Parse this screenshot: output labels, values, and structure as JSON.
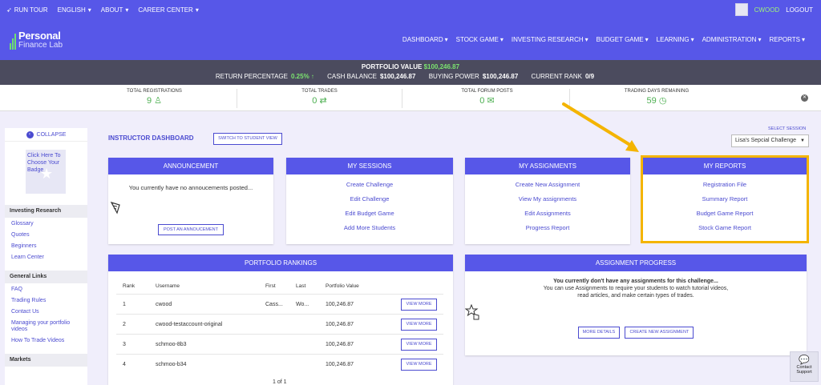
{
  "topbar": {
    "run_tour": "RUN TOUR",
    "english": "ENGLISH",
    "about": "ABOUT",
    "career_center": "CAREER CENTER",
    "username": "CWOOD",
    "logout": "LOGOUT"
  },
  "logo": {
    "line1": "Personal",
    "line2": "Finance Lab"
  },
  "nav": [
    "DASHBOARD",
    "STOCK GAME",
    "INVESTING RESEARCH",
    "BUDGET GAME",
    "LEARNING",
    "ADMINISTRATION",
    "REPORTS"
  ],
  "portfolio": {
    "value_label": "PORTFOLIO VALUE",
    "value": "$100,246.87",
    "return_label": "RETURN PERCENTAGE",
    "return_value": "0.25%",
    "cash_label": "CASH BALANCE",
    "cash_value": "$100,246.87",
    "bp_label": "BUYING POWER",
    "bp_value": "$100,246.87",
    "rank_label": "CURRENT RANK",
    "rank_value": "0/9"
  },
  "stats": [
    {
      "label": "TOTAL REGISTRATIONS",
      "value": "9"
    },
    {
      "label": "TOTAL TRADES",
      "value": "0"
    },
    {
      "label": "TOTAL FORUM POSTS",
      "value": "0"
    },
    {
      "label": "TRADING DAYS REMAINING",
      "value": "59"
    }
  ],
  "sidebar": {
    "collapse": "COLLAPSE",
    "badge": "Click Here To Choose Your Badge",
    "sections": [
      {
        "title": "Investing Research",
        "items": [
          "Glossary",
          "Quotes",
          "Beginners",
          "Learn Center"
        ]
      },
      {
        "title": "General Links",
        "items": [
          "FAQ",
          "Trading Rules",
          "Contact Us",
          "Managing your portfolio videos",
          "How To Trade Videos"
        ]
      },
      {
        "title": "Markets",
        "items": []
      }
    ]
  },
  "dashboard": {
    "title": "INSTRUCTOR DASHBOARD",
    "switch_label": "SWITCH TO STUDENT VIEW",
    "select_label": "SELECT SESSION",
    "select_value": "Lisa's Sepcial Challenge"
  },
  "announcement": {
    "title": "ANNOUNCEMENT",
    "text": "You currently have no annoucements posted...",
    "button": "POST AN ANNOUCEMENT"
  },
  "sessions": {
    "title": "MY SESSIONS",
    "links": [
      "Create Challenge",
      "Edit Challenge",
      "Edit Budget Game",
      "Add More Students"
    ]
  },
  "assignments": {
    "title": "MY ASSIGNMENTS",
    "links": [
      "Create New Assignment",
      "View My assignments",
      "Edit Assignments",
      "Progress Report"
    ]
  },
  "reports": {
    "title": "MY REPORTS",
    "links": [
      "Registration File",
      "Summary Report",
      "Budget Game Report",
      "Stock Game Report"
    ]
  },
  "rankings": {
    "title": "PORTFOLIO RANKINGS",
    "headers": {
      "rank": "Rank",
      "username": "Username",
      "first": "First",
      "last": "Last",
      "value": "Portfolio Value"
    },
    "rows": [
      {
        "rank": "1",
        "username": "cwood",
        "first": "Cass...",
        "last": "Wo...",
        "value": "100,246.87"
      },
      {
        "rank": "2",
        "username": "cwood-testaccount-original",
        "first": "",
        "last": "",
        "value": "100,246.87"
      },
      {
        "rank": "3",
        "username": "schmoo-8b3",
        "first": "",
        "last": "",
        "value": "100,246.87"
      },
      {
        "rank": "4",
        "username": "schmoo-b34",
        "first": "",
        "last": "",
        "value": "100,246.87"
      }
    ],
    "view_more": "VIEW MORE",
    "pager": "1 of 1"
  },
  "progress": {
    "title": "ASSIGNMENT PROGRESS",
    "bold": "You currently don't have any assignments for this challenge...",
    "line2": "You can use Assignments to require your students to watch tutorial videos,",
    "line3": "read articles, and make certain types of trades.",
    "more_details": "MORE DETAILS",
    "create": "CREATE NEW ASSIGNMENT"
  },
  "contact": {
    "line1": "Contact",
    "line2": "Support"
  },
  "colors": {
    "primary": "#5757e8",
    "link": "#4b4bd0",
    "green": "#7be36f",
    "highlight": "#f4b400"
  }
}
